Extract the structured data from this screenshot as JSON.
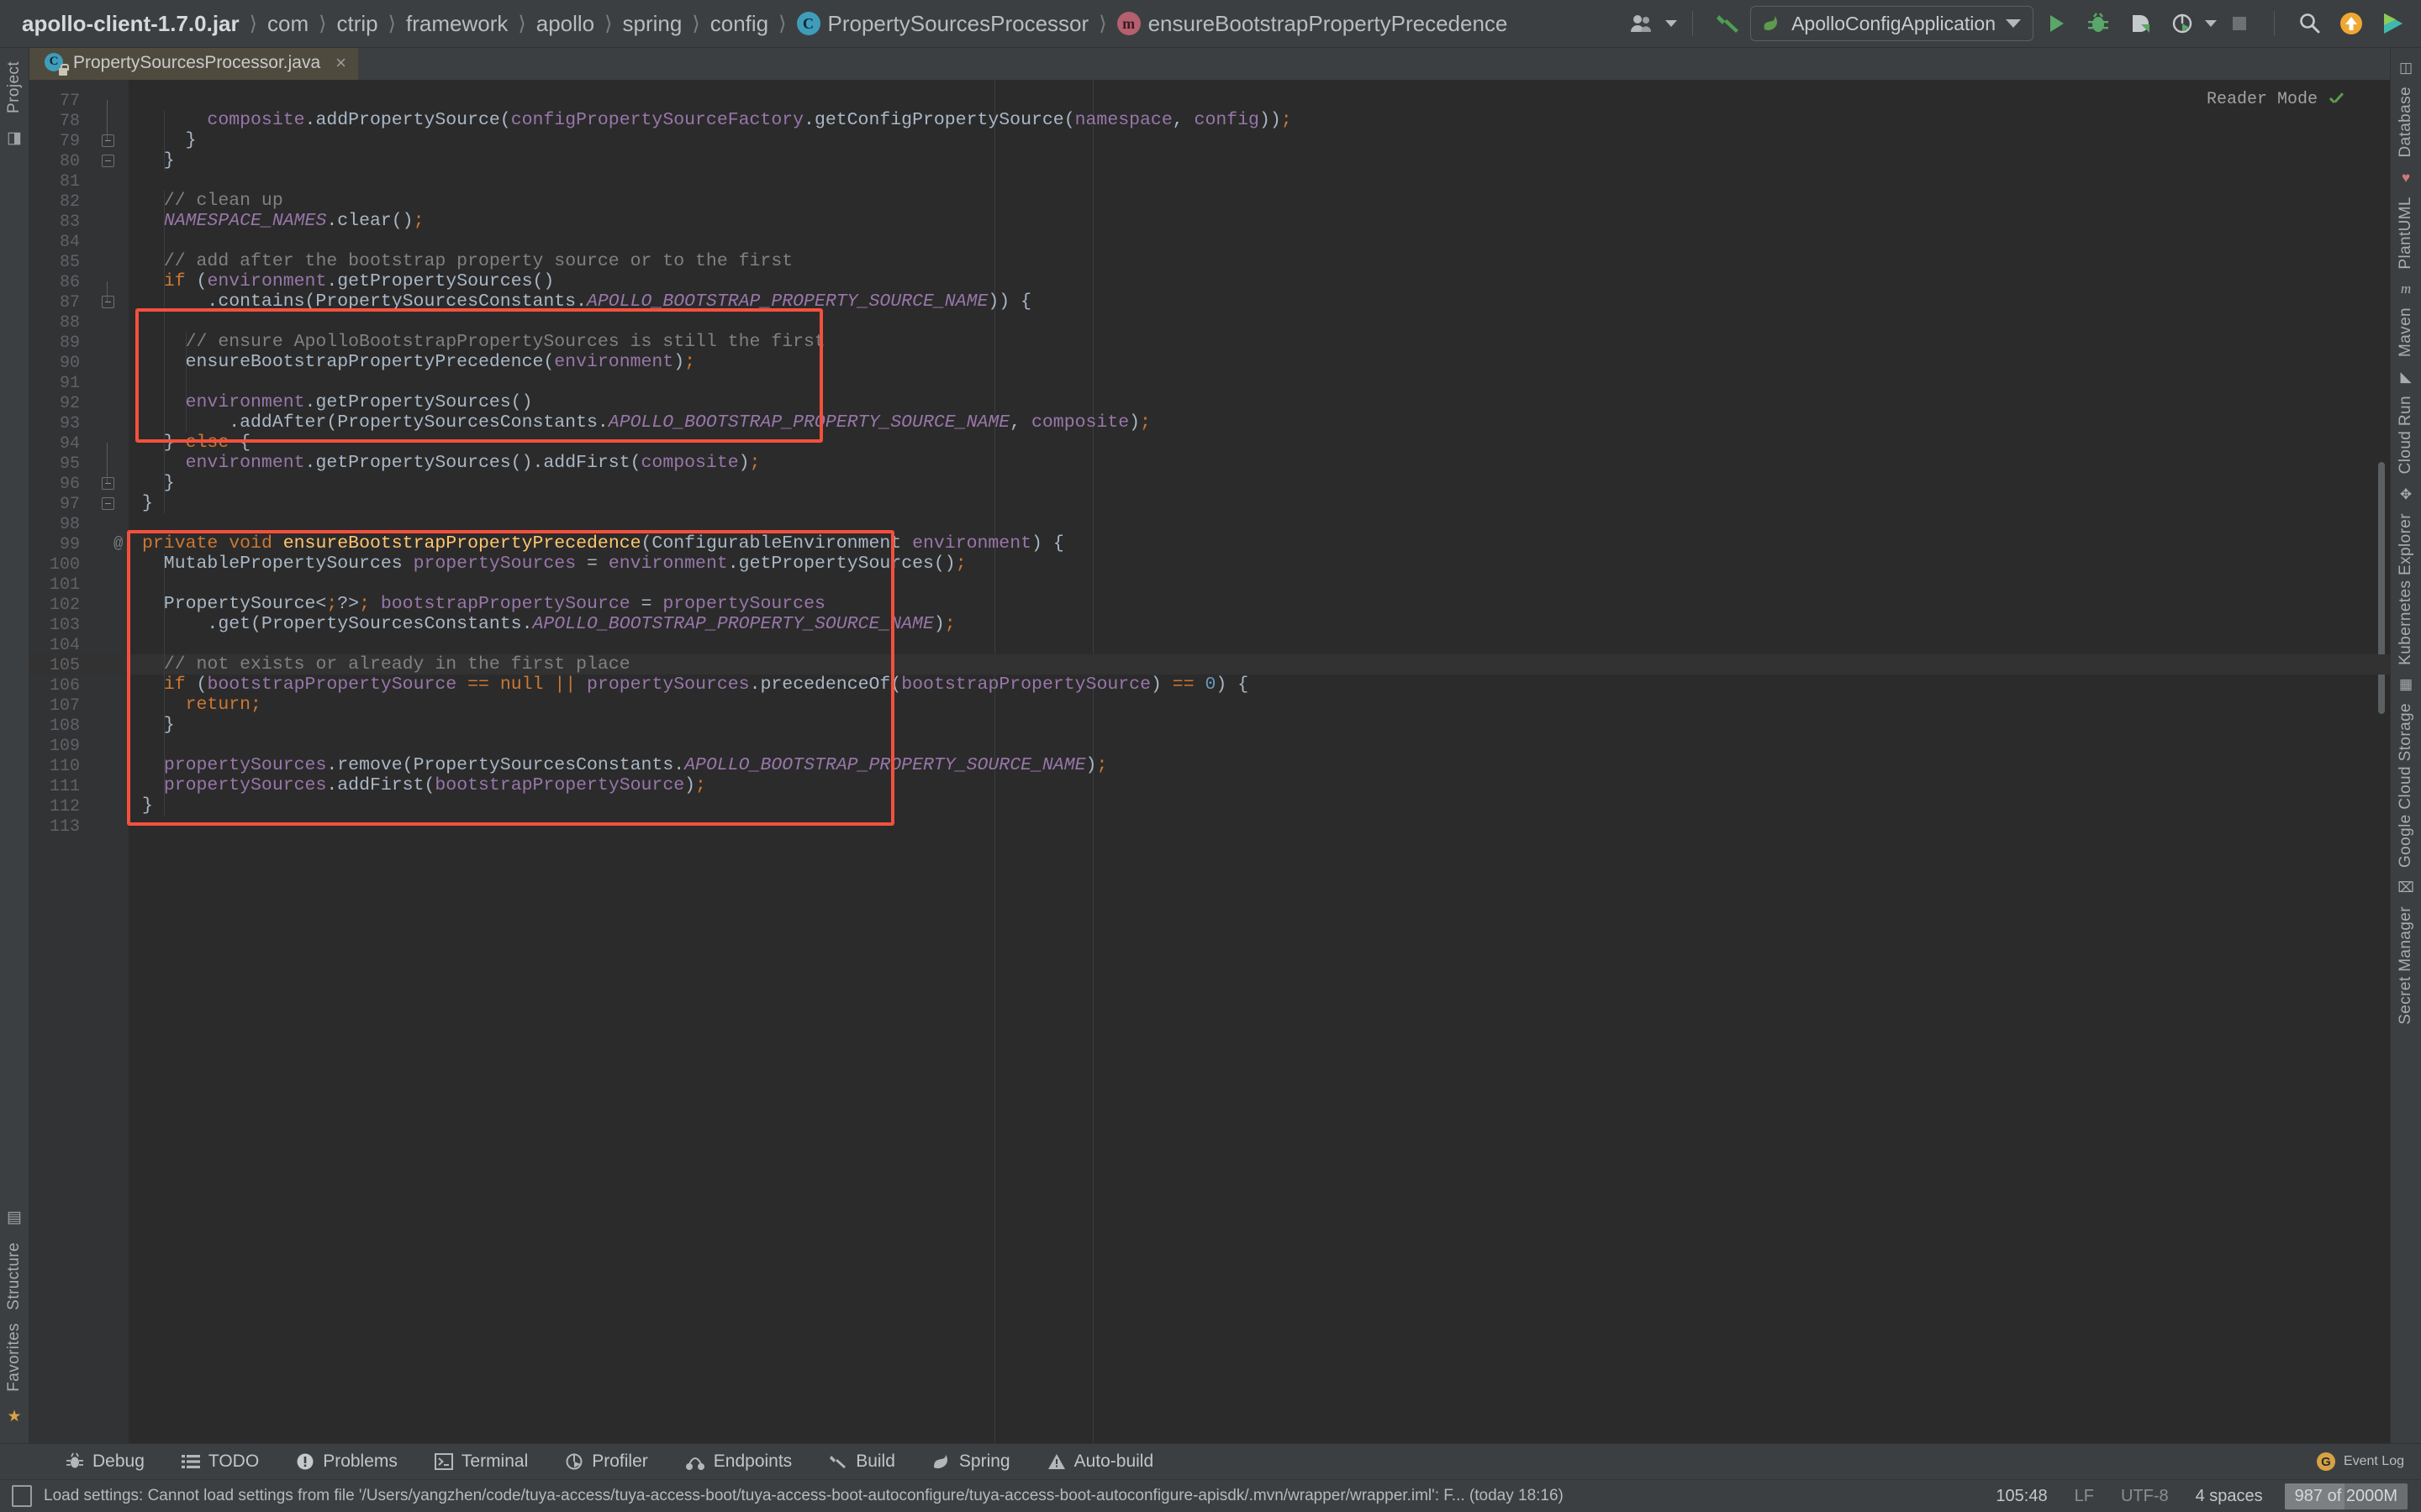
{
  "breadcrumb": {
    "root": "apollo-client-1.7.0.jar",
    "items": [
      "com",
      "ctrip",
      "framework",
      "apollo",
      "spring",
      "config"
    ],
    "class_badge": "C",
    "class_name": "PropertySourcesProcessor",
    "method_badge": "m",
    "method_name": "ensureBootstrapPropertyPrecedence",
    "separator": "〉"
  },
  "toolbar": {
    "avatar_icon": "user-icon",
    "build_icon": "hammer-icon",
    "run_config": "ApolloConfigApplication",
    "run_icon": "run-icon",
    "debug_icon": "debug-icon",
    "coverage_icon": "coverage-icon",
    "profile_icon": "profiler-icon",
    "stop_icon": "stop-icon",
    "search_icon": "search-icon",
    "update_icon": "update-arrow-icon",
    "plugin_icon": "ide-plugin-icon"
  },
  "tab": {
    "label": "PropertySourcesProcessor.java",
    "icon": "java-class-readonly-icon",
    "close": "×"
  },
  "editor": {
    "reader_mode": "Reader Mode",
    "reader_check": "check-icon",
    "first_line": 77,
    "annotation_marker": "@",
    "annotation_line": 99,
    "caret_line": 105,
    "lines": [
      {
        "n": 77,
        "text": "",
        "fold": null
      },
      {
        "n": 78,
        "text": "      composite.addPropertySource(configPropertySourceFactory.getConfigPropertySource(namespace, config));"
      },
      {
        "n": 79,
        "text": "    }",
        "fold": "end"
      },
      {
        "n": 80,
        "text": "  }",
        "fold": "end"
      },
      {
        "n": 81,
        "text": ""
      },
      {
        "n": 82,
        "text": "  // clean up"
      },
      {
        "n": 83,
        "text": "  NAMESPACE_NAMES.clear();"
      },
      {
        "n": 84,
        "text": ""
      },
      {
        "n": 85,
        "text": "  // add after the bootstrap property source or to the first"
      },
      {
        "n": 86,
        "text": "  if (environment.getPropertySources()"
      },
      {
        "n": 87,
        "text": "      .contains(PropertySourcesConstants.APOLLO_BOOTSTRAP_PROPERTY_SOURCE_NAME)) {",
        "fold": "start"
      },
      {
        "n": 88,
        "text": ""
      },
      {
        "n": 89,
        "text": "    // ensure ApolloBootstrapPropertySources is still the first"
      },
      {
        "n": 90,
        "text": "    ensureBootstrapPropertyPrecedence(environment);"
      },
      {
        "n": 91,
        "text": ""
      },
      {
        "n": 92,
        "text": "    environment.getPropertySources()"
      },
      {
        "n": 93,
        "text": "        .addAfter(PropertySourcesConstants.APOLLO_BOOTSTRAP_PROPERTY_SOURCE_NAME, composite);"
      },
      {
        "n": 94,
        "text": "  } else {"
      },
      {
        "n": 95,
        "text": "    environment.getPropertySources().addFirst(composite);"
      },
      {
        "n": 96,
        "text": "  }",
        "fold": "end"
      },
      {
        "n": 97,
        "text": "}",
        "fold": "end"
      },
      {
        "n": 98,
        "text": ""
      },
      {
        "n": 99,
        "text": "private void ensureBootstrapPropertyPrecedence(ConfigurableEnvironment environment) {"
      },
      {
        "n": 100,
        "text": "  MutablePropertySources propertySources = environment.getPropertySources();"
      },
      {
        "n": 101,
        "text": ""
      },
      {
        "n": 102,
        "text": "  PropertySource<?> bootstrapPropertySource = propertySources"
      },
      {
        "n": 103,
        "text": "      .get(PropertySourcesConstants.APOLLO_BOOTSTRAP_PROPERTY_SOURCE_NAME);"
      },
      {
        "n": 104,
        "text": ""
      },
      {
        "n": 105,
        "text": "  // not exists or already in the first place"
      },
      {
        "n": 106,
        "text": "  if (bootstrapPropertySource == null || propertySources.precedenceOf(bootstrapPropertySource) == 0) {"
      },
      {
        "n": 107,
        "text": "    return;"
      },
      {
        "n": 108,
        "text": "  }"
      },
      {
        "n": 109,
        "text": ""
      },
      {
        "n": 110,
        "text": "  propertySources.remove(PropertySourcesConstants.APOLLO_BOOTSTRAP_PROPERTY_SOURCE_NAME);"
      },
      {
        "n": 111,
        "text": "  propertySources.addFirst(bootstrapPropertySource);"
      },
      {
        "n": 112,
        "text": "}"
      },
      {
        "n": 113,
        "text": ""
      }
    ]
  },
  "left_strip": {
    "top": [
      "Project"
    ],
    "bottom": [
      "Structure",
      "Favorites"
    ]
  },
  "right_strip": {
    "items": [
      "Database",
      "PlantUML",
      "Maven",
      "Cloud Run",
      "Kubernetes Explorer",
      "Google Cloud Storage",
      "Secret Manager"
    ]
  },
  "bottom_bar": {
    "items": [
      {
        "label": "Debug",
        "icon": "bug-icon"
      },
      {
        "label": "TODO",
        "icon": "list-icon"
      },
      {
        "label": "Problems",
        "icon": "exclamation-circle-icon"
      },
      {
        "label": "Terminal",
        "icon": "terminal-icon"
      },
      {
        "label": "Profiler",
        "icon": "profiler-icon"
      },
      {
        "label": "Endpoints",
        "icon": "endpoints-icon"
      },
      {
        "label": "Build",
        "icon": "hammer-icon"
      },
      {
        "label": "Spring",
        "icon": "spring-leaf-icon"
      },
      {
        "label": "Auto-build",
        "icon": "warning-triangle-icon"
      }
    ],
    "event_log": "Event Log",
    "event_badge": "G"
  },
  "status_bar": {
    "message": "Load settings: Cannot load settings from file '/Users/yangzhen/code/tuya-access/tuya-access-boot/tuya-access-boot-autoconfigure/tuya-access-boot-autoconfigure-apisdk/.mvn/wrapper/wrapper.iml': F... (today 18:16)",
    "position": "105:48",
    "line_sep": "LF",
    "encoding": "UTF-8",
    "indent": "4 spaces",
    "memory": "987 of 2000M",
    "memory_fill_pct": 49
  },
  "colors": {
    "accent_red": "#f4503c",
    "editor_bg": "#2b2b2b",
    "chrome_bg": "#3c3f41",
    "gutter_bg": "#313335",
    "tab_active": "#4e4a3e",
    "keyword": "#cc7832",
    "field": "#9876aa",
    "string": "#6a8759",
    "comment": "#808080",
    "static_final": "#9876aa",
    "method_decl": "#ffc66d",
    "text": "#a9b7c6",
    "number": "#6897bb"
  }
}
